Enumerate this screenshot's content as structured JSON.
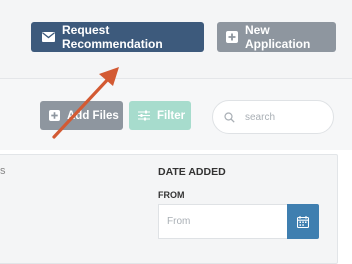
{
  "header": {
    "request_label": "Request Recommendation",
    "new_application_label": "New Application"
  },
  "toolbar": {
    "add_files_label": "Add Files",
    "filter_label": "Filter",
    "search_placeholder": "search"
  },
  "filters": {
    "date_added_title": "DATE ADDED",
    "from_label": "FROM",
    "from_placeholder": "From",
    "from_value": ""
  },
  "icons": {
    "request": "envelope-icon",
    "new_application": "plus-square-icon",
    "add_files": "plus-square-icon",
    "filter": "sliders-icon",
    "search": "search-icon",
    "calendar": "calendar-icon",
    "annotation": "arrow-annotation"
  },
  "colors": {
    "primary": "#3d5a7c",
    "secondary": "#8e969f",
    "filter": "#a7dccd",
    "calendar": "#3f7fb0",
    "annotation_arrow": "#d35a33"
  }
}
